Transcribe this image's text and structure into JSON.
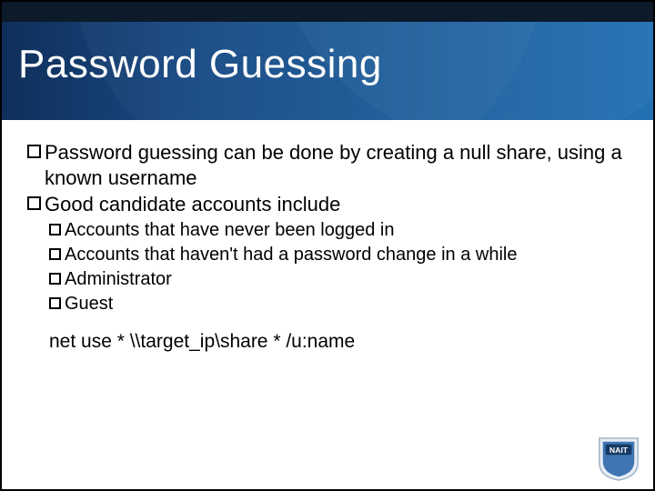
{
  "title": "Password Guessing",
  "bullets": [
    "Password guessing can be done by creating a null share, using a known username",
    "Good candidate accounts include"
  ],
  "sub_bullets": [
    "Accounts that have never been logged in",
    "Accounts that haven't had a password change in a while",
    "Administrator",
    "Guest"
  ],
  "command_line": "net use * \\\\target_ip\\share *  /u:name",
  "logo_text": "NAIT"
}
